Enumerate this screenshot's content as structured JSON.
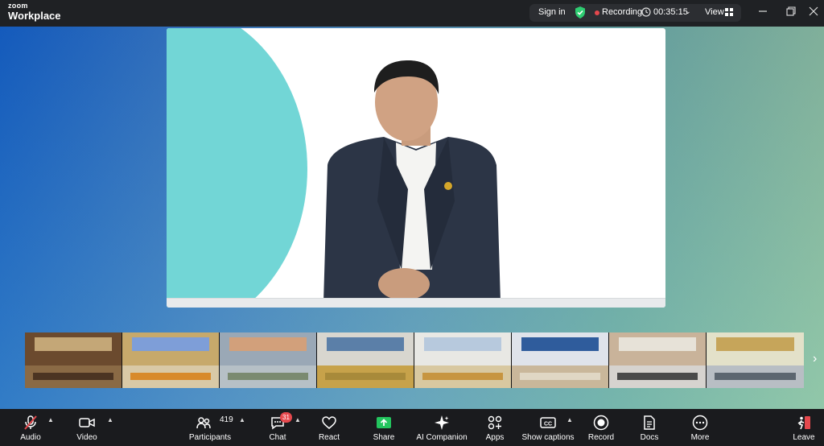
{
  "app": {
    "brand_top": "zoom",
    "brand_bottom": "Workplace"
  },
  "status": {
    "sign_in": "Sign in",
    "recording_label": "Recording",
    "timer": "00:35:15",
    "view_label": "View"
  },
  "colors": {
    "accent_green": "#2ecc71",
    "record_red": "#e5484d",
    "share_green": "#23c55e"
  },
  "main_video": {
    "speaker_description_hidden": ""
  },
  "thumbnails": {
    "count_visible": 8
  },
  "toolbar": {
    "audio": "Audio",
    "video": "Video",
    "participants": "Participants",
    "participants_count": "419",
    "chat": "Chat",
    "chat_badge": "31",
    "react": "React",
    "share": "Share",
    "ai_companion": "AI Companion",
    "apps": "Apps",
    "show_captions": "Show captions",
    "record": "Record",
    "docs": "Docs",
    "more": "More",
    "leave": "Leave"
  }
}
